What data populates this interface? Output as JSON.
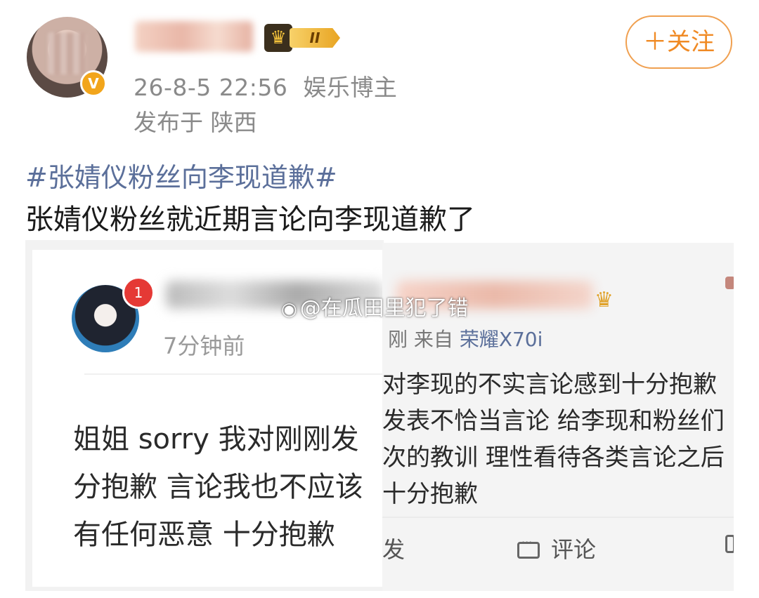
{
  "header": {
    "follow_button": "＋关注",
    "level_badge": "II",
    "post_time": "26-8-5 22:56",
    "user_category": "娱乐博主",
    "location": "发布于 陕西"
  },
  "post": {
    "hashtag": "#张婧仪粉丝向李现道歉#",
    "text": "张婧仪粉丝就近期言论向李现道歉了"
  },
  "left_screenshot": {
    "notification_count": "1",
    "time_ago": "7分钟前",
    "body_lines": [
      "姐姐 sorry 我对刚刚发",
      "分抱歉 言论我也不应该",
      "有任何恶意 十分抱歉"
    ]
  },
  "right_screenshot": {
    "meta_prefix": "刚  来自",
    "device": "荣耀X70i",
    "body_lines": [
      "对李现的不实言论感到十分抱歉",
      "发表不恰当言论 给李现和粉丝们",
      "次的教训 理性看待各类言论之后",
      "十分抱歉"
    ],
    "forward_label": "发",
    "comment_label": "评论"
  },
  "watermark": {
    "text": "@在瓜田里犯了错"
  },
  "colors": {
    "accent_orange": "#f08a24",
    "hashtag_blue": "#5b6f9a",
    "vip_gold": "#f2a51b",
    "notification_red": "#e53935"
  },
  "icons": {
    "verified": "v-badge-icon",
    "crown": "crown-icon",
    "comment": "comment-icon",
    "weibo_logo": "weibo-logo-icon"
  }
}
